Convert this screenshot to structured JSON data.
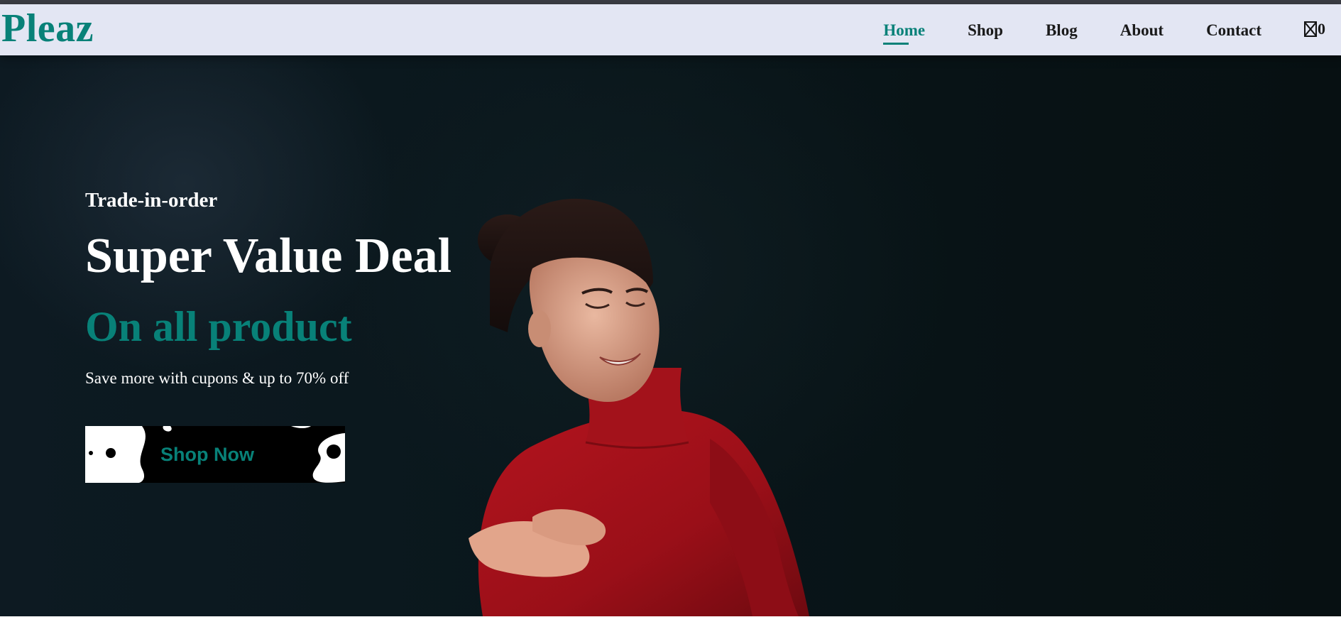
{
  "brand": {
    "logo_text": "Pleaz",
    "accent_color": "#088178"
  },
  "nav": {
    "items": [
      {
        "label": "Home",
        "active": true
      },
      {
        "label": "Shop",
        "active": false
      },
      {
        "label": "Blog",
        "active": false
      },
      {
        "label": "About",
        "active": false
      },
      {
        "label": "Contact",
        "active": false
      }
    ],
    "cart": {
      "icon": "shopping-bag-icon",
      "count": "0"
    }
  },
  "hero": {
    "eyebrow": "Trade-in-order",
    "title": "Super Value Deal",
    "subtitle": "On all product",
    "description": "Save more with cupons & up to 70% off",
    "cta_label": "Shop Now",
    "background_color": "#0b171c",
    "model_image": "woman-in-red-turtleneck"
  }
}
